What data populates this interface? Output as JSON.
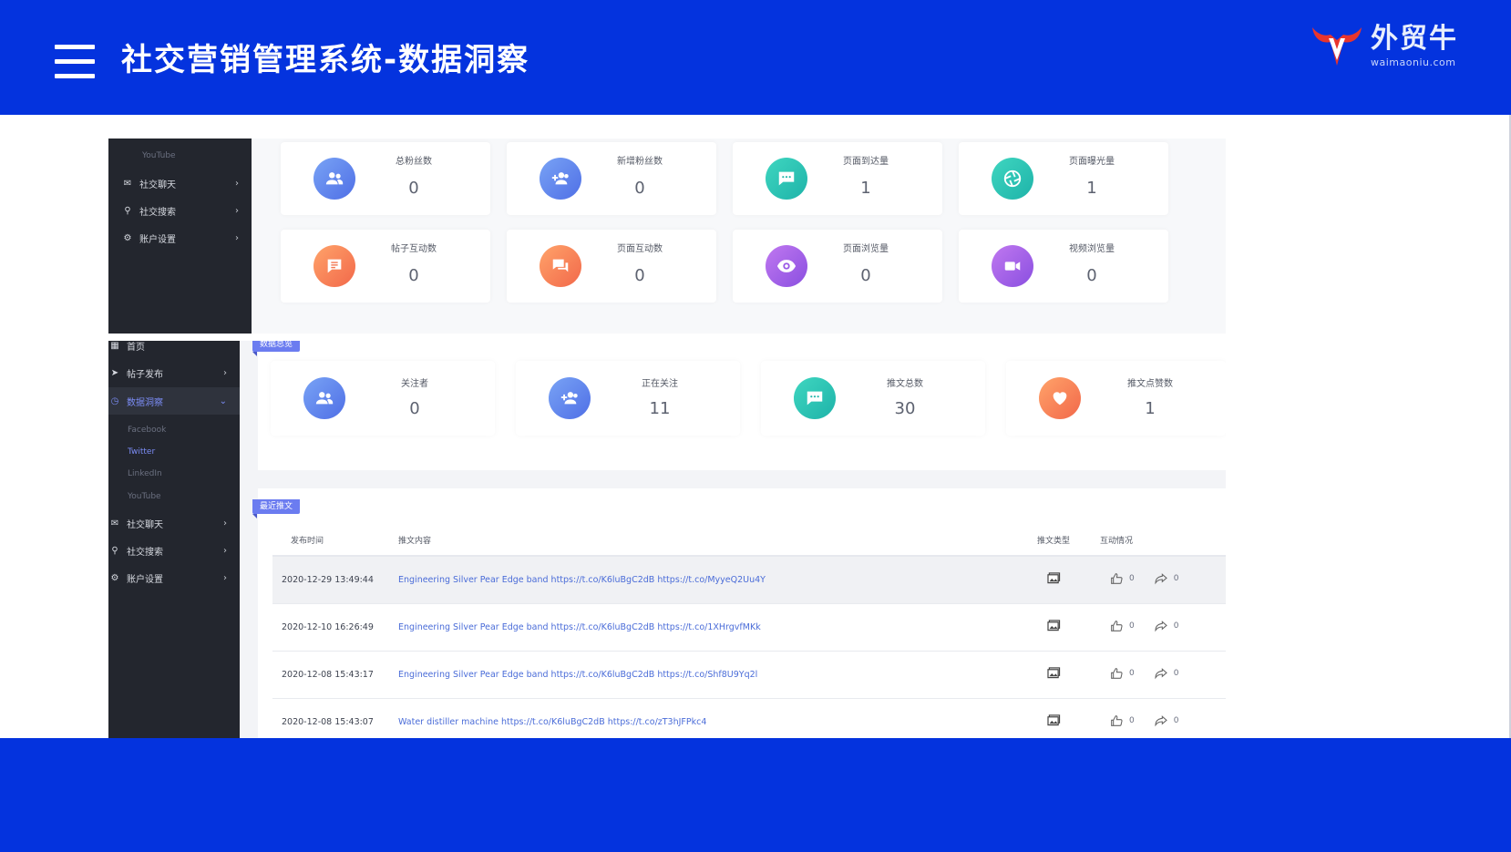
{
  "header": {
    "title": "社交营销管理系统-数据洞察",
    "logo_text": "外贸牛",
    "logo_url": "waimaoniu.com"
  },
  "screenshot_top": {
    "sidebar": {
      "sub_item": "YouTube",
      "items": [
        {
          "label": "社交聊天",
          "icon": "mail-icon"
        },
        {
          "label": "社交搜索",
          "icon": "search-icon"
        },
        {
          "label": "账户设置",
          "icon": "gear-icon"
        }
      ]
    },
    "cards": [
      {
        "label": "总粉丝数",
        "value": "0",
        "icon": "users-icon",
        "color": "blue"
      },
      {
        "label": "新增粉丝数",
        "value": "0",
        "icon": "user-add-icon",
        "color": "blue"
      },
      {
        "label": "页面到达量",
        "value": "1",
        "icon": "comment-icon",
        "color": "teal"
      },
      {
        "label": "页面曝光量",
        "value": "1",
        "icon": "aperture-icon",
        "color": "teal"
      },
      {
        "label": "帖子互动数",
        "value": "0",
        "icon": "post-icon",
        "color": "orange"
      },
      {
        "label": "页面互动数",
        "value": "0",
        "icon": "chat-icon",
        "color": "orange"
      },
      {
        "label": "页面浏览量",
        "value": "0",
        "icon": "eye-icon",
        "color": "purple"
      },
      {
        "label": "视频浏览量",
        "value": "0",
        "icon": "video-icon",
        "color": "purple"
      }
    ]
  },
  "screenshot_bottom": {
    "sidebar": {
      "items": [
        {
          "label": "首页",
          "icon": "dashboard-icon"
        },
        {
          "label": "帖子发布",
          "icon": "send-icon"
        },
        {
          "label": "数据洞察",
          "icon": "clock-icon"
        }
      ],
      "sub_items": [
        "Facebook",
        "Twitter",
        "LinkedIn",
        "YouTube"
      ],
      "lower_items": [
        {
          "label": "社交聊天",
          "icon": "mail-icon"
        },
        {
          "label": "社交搜索",
          "icon": "search-icon"
        },
        {
          "label": "账户设置",
          "icon": "gear-icon"
        }
      ]
    },
    "overview_tag": "数据总览",
    "overview_cards": [
      {
        "label": "关注者",
        "value": "0",
        "icon": "users-icon",
        "color": "blue"
      },
      {
        "label": "正在关注",
        "value": "11",
        "icon": "user-add-icon",
        "color": "blue"
      },
      {
        "label": "推文总数",
        "value": "30",
        "icon": "comment-icon",
        "color": "teal"
      },
      {
        "label": "推文点赞数",
        "value": "1",
        "icon": "heart-icon",
        "color": "orange"
      }
    ],
    "recent_tag": "最近推文",
    "table": {
      "columns": [
        "发布时间",
        "推文内容",
        "推文类型",
        "互动情况"
      ],
      "rows": [
        {
          "time": "2020-12-29 13:49:44",
          "content": "Engineering Silver Pear Edge band https://t.co/K6luBgC2dB https://t.co/MyyeQ2Uu4Y",
          "likes": "0",
          "shares": "0"
        },
        {
          "time": "2020-12-10 16:26:49",
          "content": "Engineering Silver Pear Edge band https://t.co/K6luBgC2dB https://t.co/1XHrgvfMKk",
          "likes": "0",
          "shares": "0"
        },
        {
          "time": "2020-12-08 15:43:17",
          "content": "Engineering Silver Pear Edge band https://t.co/K6luBgC2dB https://t.co/Shf8U9Yq2l",
          "likes": "0",
          "shares": "0"
        },
        {
          "time": "2020-12-08 15:43:07",
          "content": "Water distiller machine https://t.co/K6luBgC2dB https://t.co/zT3hJFPkc4",
          "likes": "0",
          "shares": "0"
        }
      ]
    }
  }
}
